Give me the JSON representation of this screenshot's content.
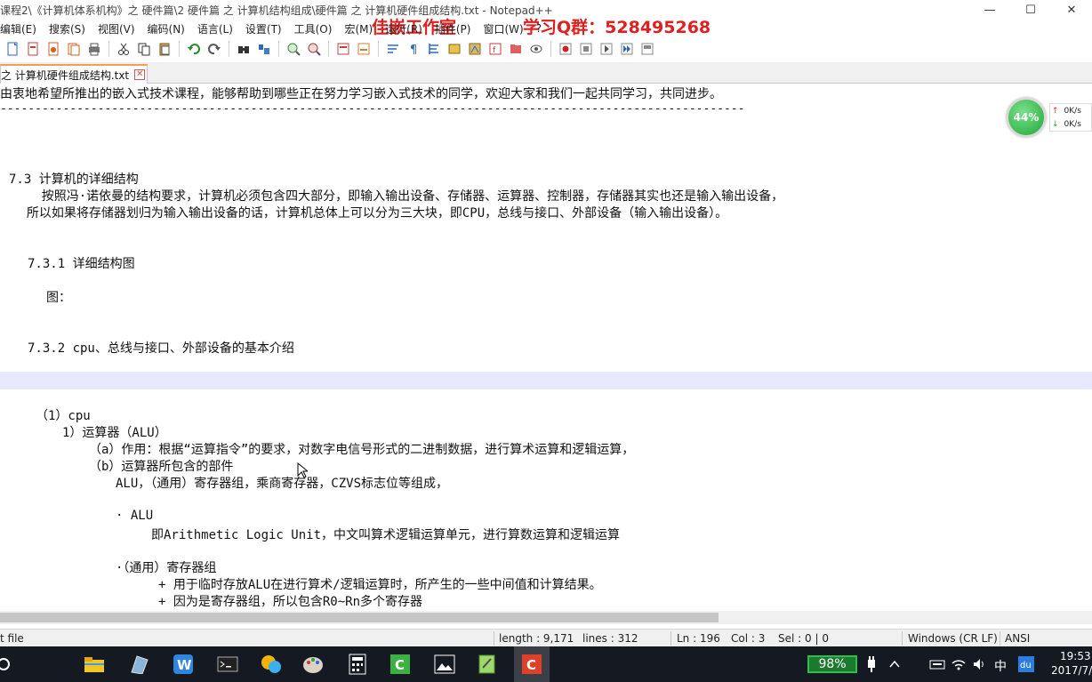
{
  "window": {
    "title": "课程2\\《计算机体系机构》之 硬件篇\\2 硬件篇 之 计算机结构组成\\硬件篇 之 计算机硬件组成结构.txt - Notepad++",
    "overlay_studio": "佳嵌工作室",
    "overlay_qq": "学习Q群：528495268",
    "controls": {
      "minimize": "—",
      "maximize": "☐",
      "close": "✕"
    }
  },
  "menubar": {
    "items": [
      "编辑(E)",
      "搜索(S)",
      "视图(V)",
      "编码(N)",
      "语言(L)",
      "设置(T)",
      "工具(O)",
      "宏(M)",
      "运行(R)",
      "插件(P)",
      "窗口(W)",
      "?"
    ]
  },
  "tab": {
    "label": "之 计算机硬件组成结构.txt"
  },
  "editor": {
    "lines": [
      "由衷地希望所推出的嵌入式技术课程，能够帮助到哪些正在努力学习嵌入式技术的同学，欢迎大家和我们一起共同学习，共同进步。",
      "-----------------------------------------------------------------------------------------------------------",
      "7.3 计算机的详细结构",
      "    按照冯·诺依曼的结构要求，计算机必须包含四大部分，即输入输出设备、存储器、运算器、控制器，存储器其实也还是输入输出设备，",
      "  所以如果将存储器划归为输入输出设备的话，计算机总体上可以分为三大块，即CPU，总线与接口、外部设备（输入输出设备）。",
      "7.3.1 详细结构图",
      "图：",
      "7.3.2 cpu、总线与接口、外部设备的基本介绍",
      "（1）cpu",
      "1）运算器（ALU）",
      "（a）作用：根据“运算指令”的要求，对数字电信号形式的二进制数据，进行算术运算和逻辑运算，",
      "（b）运算器所包含的部件",
      "ALU，（通用）寄存器组，乘商寄存器，CZVS标志位等组成，",
      "· ALU",
      "即Arithmetic Logic Unit，中文叫算术逻辑运算单元，进行算数运算和逻辑运算",
      "·（通用）寄存器组",
      "+ 用于临时存放ALU在进行算术/逻辑运算时，所产生的一些中间值和计算结果。",
      "+ 因为是寄存器组，所以包含R0~Rn多个寄存器"
    ]
  },
  "netwidget": {
    "percent": "44%",
    "up_rate": "0K/s",
    "down_rate": "0K/s"
  },
  "statusbar": {
    "filetype": "t file",
    "length": "length : 9,171",
    "lines": "lines : 312",
    "ln": "Ln : 196",
    "col": "Col : 3",
    "sel": "Sel : 0 | 0",
    "eol": "Windows (CR LF)",
    "encoding": "ANSI"
  },
  "taskbar": {
    "battery": "98%",
    "ime": "中",
    "time": "19:53",
    "date": "2017/7/"
  },
  "colors": {
    "overlay_red": "#e02020",
    "tab_accent": "#f0a050",
    "taskbar_bg": "#151a22",
    "battery_green": "#2cc04a"
  }
}
